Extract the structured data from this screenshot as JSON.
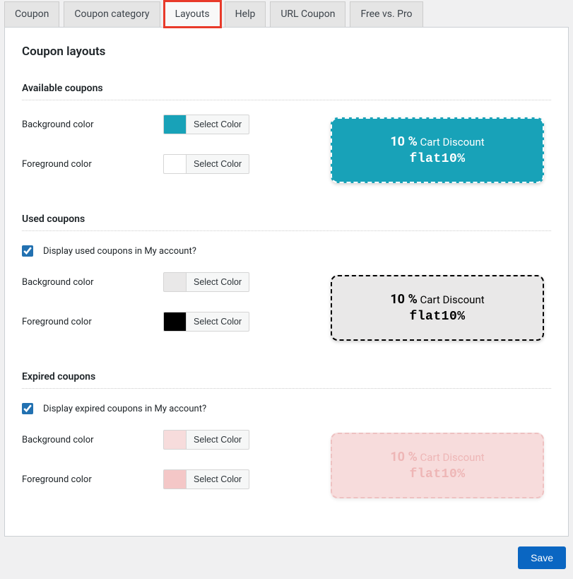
{
  "tabs": {
    "coupon": "Coupon",
    "coupon_category": "Coupon category",
    "layouts": "Layouts",
    "help": "Help",
    "url_coupon": "URL Coupon",
    "free_vs_pro": "Free vs. Pro"
  },
  "page_title": "Coupon layouts",
  "select_color_label": "Select Color",
  "coupon_preview": {
    "percent": "10 %",
    "desc": "Cart Discount",
    "code": "flat10%"
  },
  "sections": {
    "available": {
      "heading": "Available coupons",
      "bg_label": "Background color",
      "fg_label": "Foreground color",
      "bg_color": "#18a2b8",
      "fg_color": "#ffffff"
    },
    "used": {
      "heading": "Used coupons",
      "checkbox_label": "Display used coupons in My account?",
      "bg_label": "Background color",
      "fg_label": "Foreground color",
      "bg_color": "#e9e8e8",
      "fg_color": "#000000"
    },
    "expired": {
      "heading": "Expired coupons",
      "checkbox_label": "Display expired coupons in My account?",
      "bg_label": "Background color",
      "fg_label": "Foreground color",
      "bg_color": "#f7dcdc",
      "fg_color": "#f4c7c7"
    }
  },
  "save_label": "Save"
}
